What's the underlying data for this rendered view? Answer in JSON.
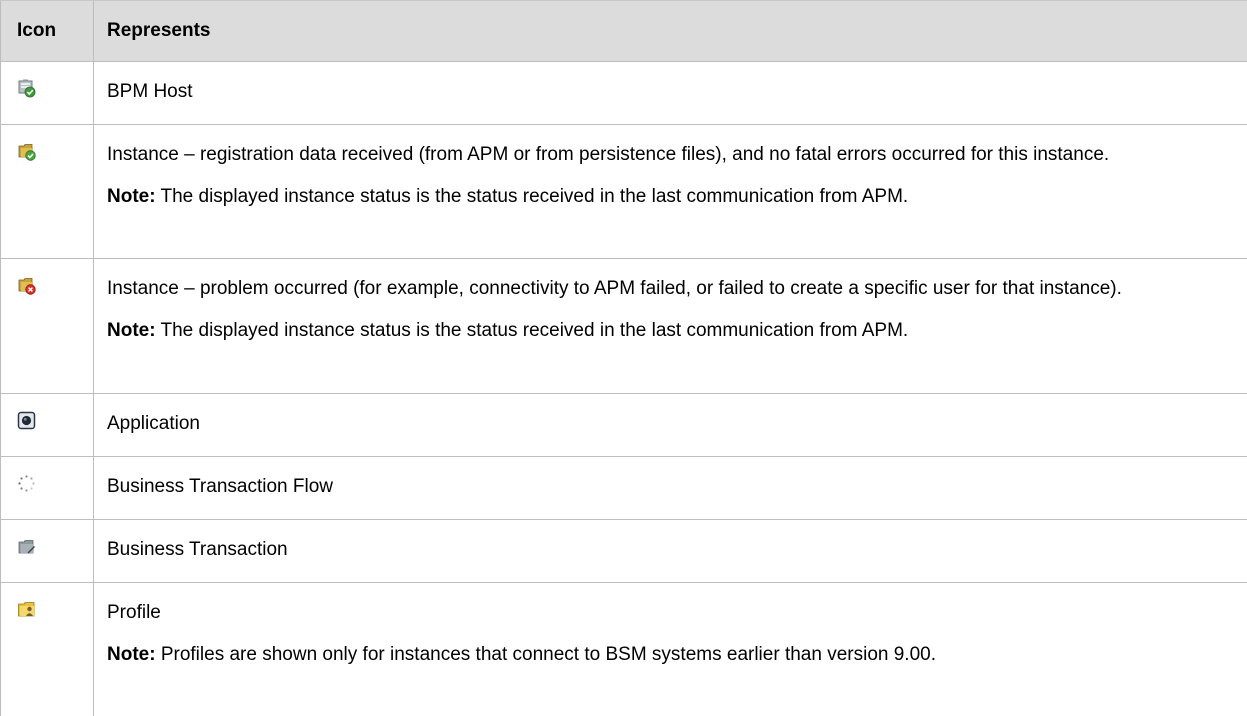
{
  "header": {
    "icon_col": "Icon",
    "represents_col": "Represents"
  },
  "rows": [
    {
      "icon": "bpm-host-icon",
      "text": "BPM Host"
    },
    {
      "icon": "instance-ok-icon",
      "text": "Instance – registration data received (from APM or from persistence files), and no fatal errors occurred for this instance.",
      "note_label": "Note:",
      "note": " The displayed instance status is the status received in the last communication from APM."
    },
    {
      "icon": "instance-error-icon",
      "text": "Instance – problem occurred (for example, connectivity to APM failed, or failed to create a specific user for that instance).",
      "note_label": "Note:",
      "note": " The displayed instance status is the status received in the last communication from APM."
    },
    {
      "icon": "application-icon",
      "text": "Application"
    },
    {
      "icon": "business-transaction-flow-icon",
      "text": "Business Transaction Flow"
    },
    {
      "icon": "business-transaction-icon",
      "text": "Business Transaction"
    },
    {
      "icon": "profile-icon",
      "text": "Profile",
      "note_label": "Note:",
      "note": " Profiles are shown only for instances that connect to BSM systems earlier than version 9.00."
    }
  ]
}
